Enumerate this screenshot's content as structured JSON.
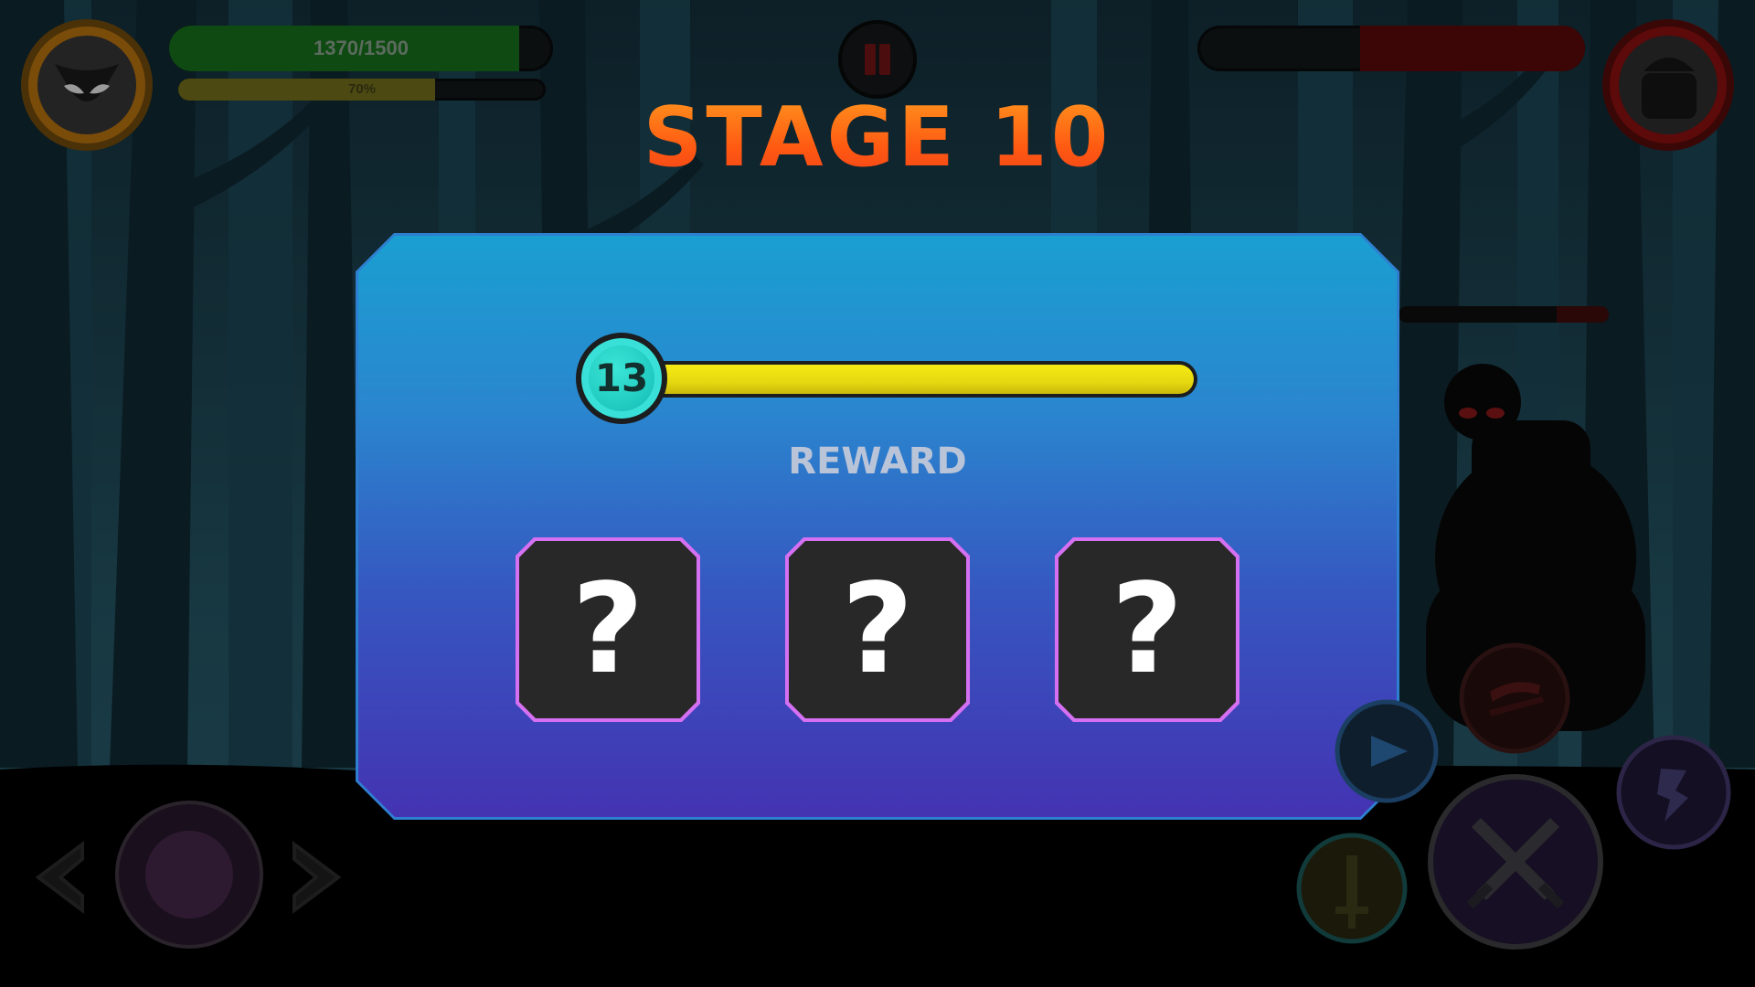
{
  "hud": {
    "player_hp_text": "1370/1500",
    "player_hp_fraction": 0.913,
    "player_xp_text": "70%",
    "player_xp_fraction": 0.7,
    "enemy_hp_fraction": 0.58,
    "enemy_minibar_fraction": 0.25
  },
  "stage": {
    "title": "STAGE 10"
  },
  "panel": {
    "level": "13",
    "level_progress": 1.0,
    "reward_label": "REWARD",
    "rewards": [
      "?",
      "?",
      "?"
    ]
  },
  "colors": {
    "title_orange": "#ff6a12",
    "panel_top": "#1a9fd1",
    "panel_bottom": "#4433b2",
    "level_bar": "#f5ea14",
    "level_badge": "#38e0d7",
    "reward_border": "#d670f2",
    "reward_bg": "#282828"
  },
  "icons": {
    "player_portrait": "masked-cat-icon",
    "enemy_portrait": "ogre-icon",
    "pause": "pause-icon",
    "move_left": "arrow-left-icon",
    "move_right": "arrow-right-icon",
    "attack": "crossed-swords-icon",
    "skill_1": "sword-shield-icon",
    "skill_2": "slash-icon",
    "skill_3": "dash-icon",
    "skill_4": "arrow-icon"
  }
}
